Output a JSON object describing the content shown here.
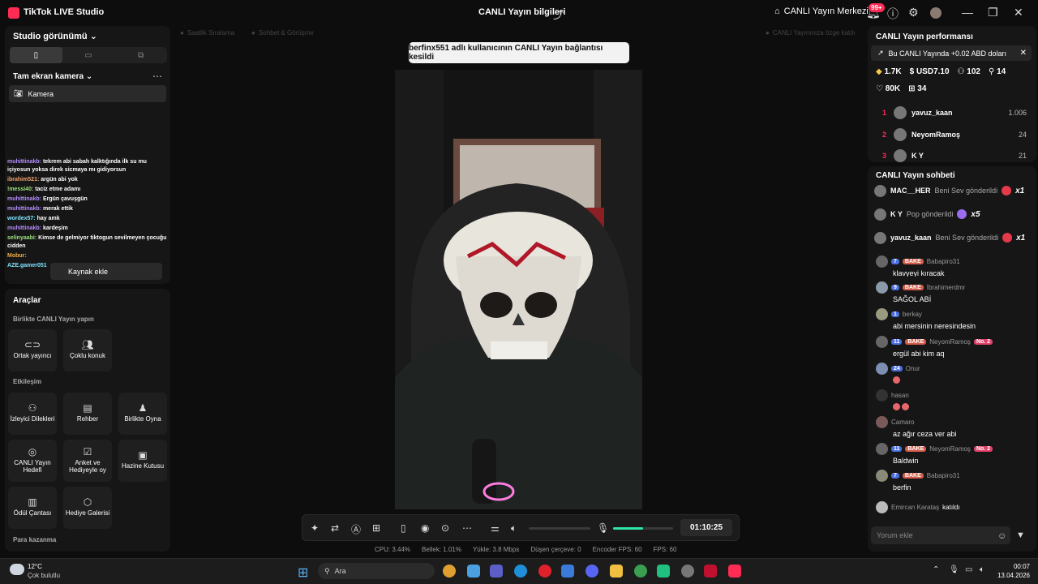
{
  "titlebar": {
    "app_title": "TikTok LIVE Studio",
    "center_title": "CANLI Yayın bilgileri",
    "center_button": "CANLI Yayın Merkezi",
    "notif_count": "99+"
  },
  "left": {
    "studio_title": "Studio görünümü",
    "scene_title": "Tam ekran kamera",
    "camera_label": "Kamera",
    "add_source": "Kaynak ekle",
    "overlay_chat": [
      {
        "user": "muhittinakb:",
        "text": "tekrem abi sabah kalktığında ilk su mu içiyosun yoksa direk sicmaya mı gidiyorsun"
      },
      {
        "user": "ibrahim521:",
        "text": "argün abi yok"
      },
      {
        "user": "!messi40:",
        "text": "taciz etme adamı"
      },
      {
        "user": "muhittinakb:",
        "text": "Ergün çavuşgün"
      },
      {
        "user": "muhittinakb:",
        "text": "merak ettik"
      },
      {
        "user": "wordex57:",
        "text": "hay amk"
      },
      {
        "user": "muhittinakb:",
        "text": "kardeşim"
      },
      {
        "user": "selinyaabi:",
        "text": "Kimse de gelmiyor tiktogun sevilmeyen çocuğu cidden"
      },
      {
        "user": "Mobur:",
        "text": ""
      },
      {
        "user": "AZE.gamer051",
        "text": ""
      }
    ],
    "tools": {
      "title": "Araçlar",
      "section1": "Birlikte CANLI Yayın yapın",
      "section2": "Etkileşim",
      "section3": "Para kazanma",
      "items_together": [
        "Ortak yayıncı",
        "Çoklu konuk"
      ],
      "items_interaction": [
        "İzleyici Dilekleri",
        "Rehber",
        "Birlikte Oyna",
        "CANLI Yayın Hedefi",
        "Anket ve Hediyeyle oy",
        "Hazine Kutusu",
        "Ödül Çantası",
        "Hediye Galerisi"
      ]
    }
  },
  "center": {
    "dim_tabs": [
      "Saatlik Sıralama",
      "Sohbet & Görüşme",
      "CANLI Yayınınıza özge katılı"
    ],
    "toast": "berfinx551 adlı kullanıcının CANLI Yayın bağlantısı kesildi",
    "timer": "01:10:25",
    "mic_level": 0.5,
    "stats": [
      "CPU:  3.44%",
      "Bellek:  1.01%",
      "Yükle:  3.8 Mbps",
      "Düşen çerçeve:  0",
      "Encoder FPS:  60",
      "FPS:  60"
    ]
  },
  "performance": {
    "title": "CANLI Yayın performansı",
    "banner": "Bu CANLI Yayında +0.02 ABD doları",
    "metrics_row1": [
      "1.7K",
      "USD7.10",
      "102",
      "14"
    ],
    "metrics_row2": [
      "80K",
      "34"
    ],
    "ranking": [
      {
        "rank": "1",
        "name": "yavuz_kaan",
        "value": "1.006"
      },
      {
        "rank": "2",
        "name": "NeyomRamoş",
        "value": "24"
      },
      {
        "rank": "3",
        "name": "K Y",
        "value": "21"
      }
    ]
  },
  "chat": {
    "title": "CANLI Yayın sohbeti",
    "gifts": [
      {
        "name": "MAC__HER",
        "text": "Beni Sev gönderildi",
        "count": "x1"
      },
      {
        "name": "K Y",
        "text": "Pop gönderildi",
        "count": "x5"
      },
      {
        "name": "yavuz_kaan",
        "text": "Beni Sev gönderildi",
        "count": "x1"
      }
    ],
    "messages": [
      {
        "user": "Babapiro31",
        "text": "klavyeyi kıracak",
        "level": "7",
        "fan": "BAKE",
        "no": ""
      },
      {
        "user": "İbrahimerdmr",
        "text": "SAĞOL ABİ",
        "level": "9",
        "fan": "BAKE",
        "no": ""
      },
      {
        "user": "berkay",
        "text": "abi mersinin neresindesin",
        "level": "1",
        "fan": "",
        "no": ""
      },
      {
        "user": "NeyomRamoş",
        "text": "ergül abi kim aq",
        "level": "11",
        "fan": "BAKE",
        "no": "No. 2"
      },
      {
        "user": "Onur",
        "text": "",
        "level": "24",
        "fan": "",
        "no": ""
      },
      {
        "user": "hasan",
        "text": "",
        "level": "",
        "fan": "",
        "no": ""
      },
      {
        "user": "Camaro",
        "text": "az ağır ceza ver abi",
        "level": "",
        "fan": "",
        "no": ""
      },
      {
        "user": "NeyomRamoş",
        "text": "Baldwin",
        "level": "11",
        "fan": "BAKE",
        "no": "No. 2"
      },
      {
        "user": "Babapiro31",
        "text": "berfin",
        "level": "7",
        "fan": "BAKE",
        "no": ""
      }
    ],
    "joined_user": "Emircan Karataş",
    "joined_text": "katıldı",
    "comment_placeholder": "Yorum ekle"
  },
  "taskbar": {
    "temp": "12°C",
    "weather": "Çok bulutlu",
    "search": "Ara",
    "time": "00:07",
    "date": "13.04.2026"
  }
}
